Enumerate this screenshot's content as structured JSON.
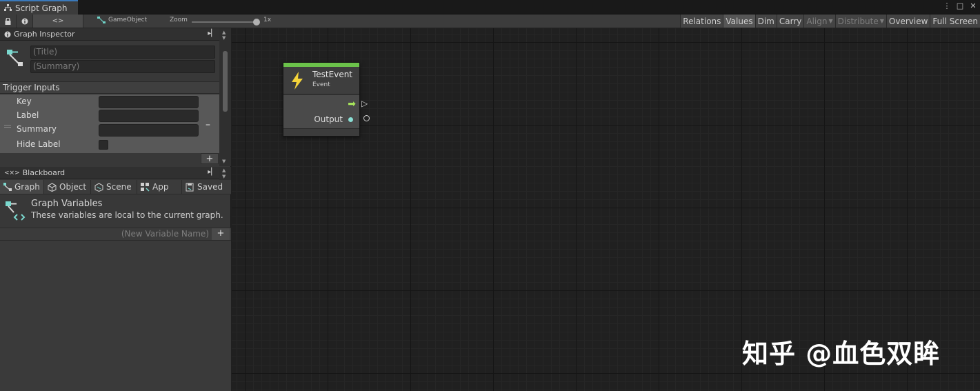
{
  "window": {
    "tab_title": "Script Graph",
    "controls": [
      "⋮",
      "□",
      "✕"
    ]
  },
  "toolbar": {
    "code_label": "<>",
    "gameobject_label": "GameObject",
    "zoom_label": "Zoom",
    "zoom_value": "1x",
    "zoom_level": 1.0,
    "right_buttons": [
      {
        "label": "Relations",
        "state": "normal"
      },
      {
        "label": "Values",
        "state": "active"
      },
      {
        "label": "Dim",
        "state": "normal"
      },
      {
        "label": "Carry",
        "state": "normal"
      },
      {
        "label": "Align",
        "state": "disabled",
        "dropdown": true
      },
      {
        "label": "Distribute",
        "state": "disabled",
        "dropdown": true
      },
      {
        "label": "Overview",
        "state": "normal"
      },
      {
        "label": "Full Screen",
        "state": "normal"
      }
    ]
  },
  "inspector": {
    "header": "Graph Inspector",
    "title_placeholder": "(Title)",
    "summary_placeholder": "(Summary)",
    "trigger_section": "Trigger Inputs",
    "fields": {
      "key_label": "Key",
      "label_label": "Label",
      "summary_label": "Summary",
      "hide_label_label": "Hide Label"
    },
    "add_symbol": "+",
    "remove_symbol": "–"
  },
  "blackboard": {
    "header": "Blackboard",
    "tabs": [
      "Graph",
      "Object",
      "Scene",
      "App",
      "Saved"
    ],
    "active_tab": "Graph",
    "variables_title": "Graph Variables",
    "variables_desc": "These variables are local to the current graph.",
    "new_variable_placeholder": "(New Variable Name)",
    "add_symbol": "+"
  },
  "node": {
    "title": "TestEvent",
    "subtitle": "Event",
    "output_label": "Output",
    "accent_color": "#6bc24a"
  },
  "watermark": "知乎 @血色双眸"
}
